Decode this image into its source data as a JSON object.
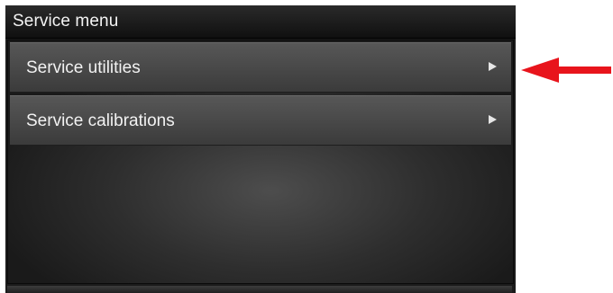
{
  "header": {
    "title": "Service menu"
  },
  "menu": {
    "items": [
      {
        "label": "Service utilities",
        "icon": "chevron-right-icon"
      },
      {
        "label": "Service calibrations",
        "icon": "chevron-right-icon"
      }
    ]
  },
  "annotation": {
    "icon": "arrow-left-icon",
    "color": "#e8141c"
  }
}
